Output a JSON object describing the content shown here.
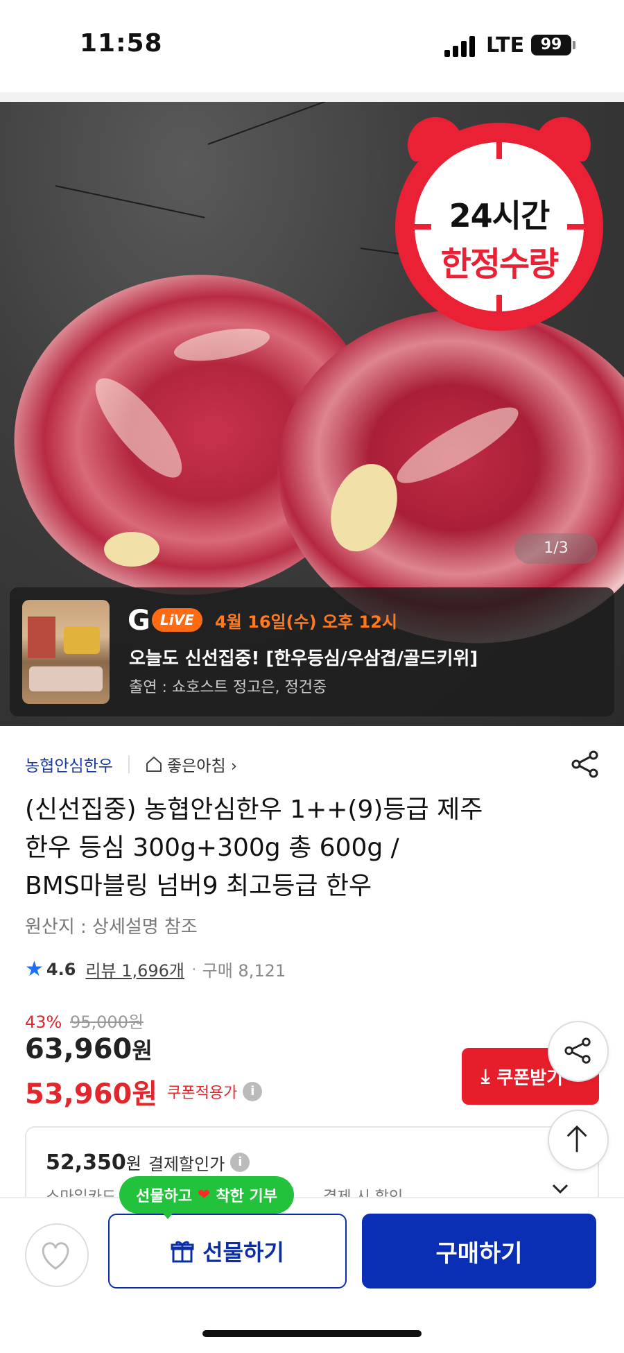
{
  "status_bar": {
    "time": "11:58",
    "network": "LTE",
    "battery": "99"
  },
  "hero": {
    "badge_line1": "24시간",
    "badge_line2": "한정수량",
    "image_counter": "1/3"
  },
  "live": {
    "logo_letter": "G",
    "live_label": "LiVE",
    "date": "4월 16일(수) 오후 12시",
    "title": "오늘도 신선집중! [한우등심/우삼겹/골드키위]",
    "cast": "출연 : 쇼호스트 정고은, 정건중"
  },
  "product": {
    "store": "농협안심한우",
    "brand_link": "좋은아침 ›",
    "title_lines": [
      "(신선집중) 농협안심한우 1++(9)등급 제주",
      "한우 등심 300g+300g 총 600g /",
      "BMS마블링 넘버9 최고등급 한우"
    ],
    "origin": "원산지 : 상세설명 참조",
    "rating": "4.6",
    "reviews": "리뷰 1,696개",
    "separator": "·",
    "purchases": "구매 8,121",
    "discount_pct": "43%",
    "original_price": "95,000원",
    "price_amount": "63,960",
    "price_unit": "원",
    "coupon_price": "53,960원",
    "coupon_label": "쿠폰적용가",
    "coupon_button": "쿠폰받기",
    "info_glyph": "i"
  },
  "payment": {
    "amount": "52,350",
    "unit": "원",
    "label": "결제할인가",
    "sub_left": "스마일카드",
    "sub_right": "결제 시 할인"
  },
  "bottom_bar": {
    "gift_tooltip_left": "선물하고",
    "gift_tooltip_heart": "❤",
    "gift_tooltip_right": "착한 기부",
    "gift_button": "선물하기",
    "buy_button": "구매하기"
  },
  "colors": {
    "brand_blue": "#0a2fb4",
    "sale_red": "#e1262c",
    "live_orange": "#ff6a13",
    "tooltip_green": "#22c23c"
  }
}
